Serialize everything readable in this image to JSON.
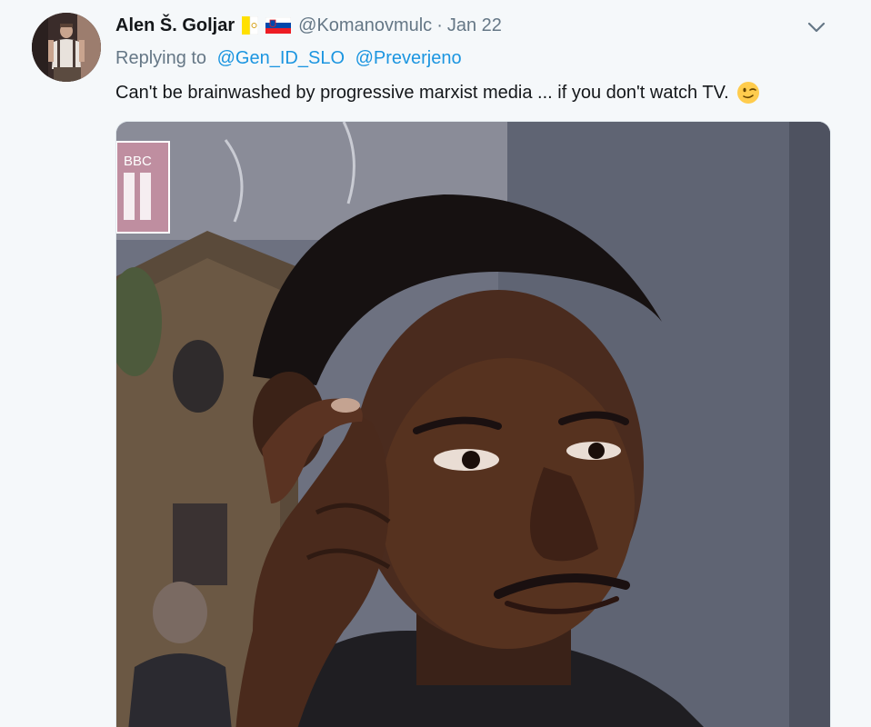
{
  "tweet": {
    "display_name": "Alen Š. Goljar",
    "flags": [
      "vatican-flag",
      "slovenia-flag"
    ],
    "handle": "@Komanovmulc",
    "separator": "·",
    "date": "Jan 22",
    "replying_prefix": "Replying to",
    "replying_to": [
      "@Gen_ID_SLO",
      "@Preverjeno"
    ],
    "text": "Can't be brainwashed by progressive marxist media ... if you don't watch TV.",
    "emoji": "winking-face",
    "media_logo_text": "BBC",
    "media_logo_mark": "!!"
  },
  "colors": {
    "background": "#f5f8fa",
    "name": "#14171a",
    "secondary": "#657786",
    "link": "#1b95e0"
  },
  "icons": {
    "menu": "chevron-down-icon"
  }
}
